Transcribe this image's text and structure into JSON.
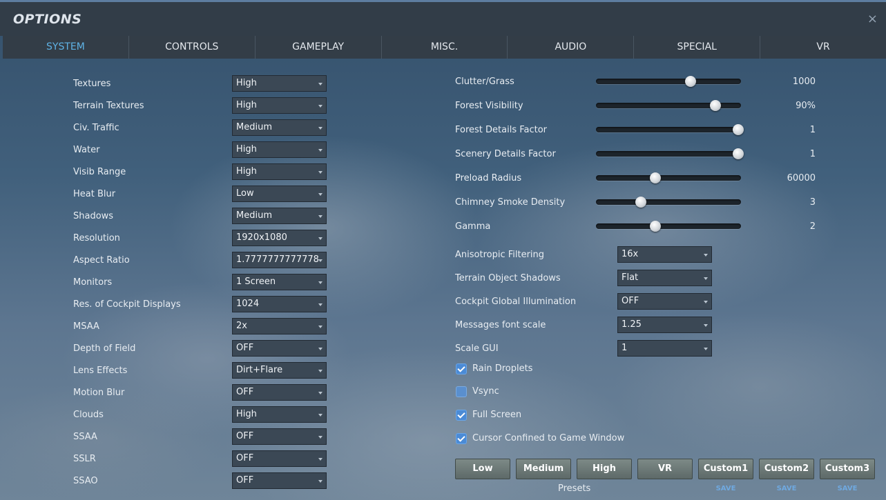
{
  "window": {
    "title": "OPTIONS",
    "close_symbol": "×"
  },
  "tabs": [
    {
      "label": "SYSTEM",
      "active": true
    },
    {
      "label": "CONTROLS"
    },
    {
      "label": "GAMEPLAY"
    },
    {
      "label": "MISC."
    },
    {
      "label": "AUDIO"
    },
    {
      "label": "SPECIAL"
    },
    {
      "label": "VR"
    }
  ],
  "left_settings": [
    {
      "label": "Textures",
      "value": "High"
    },
    {
      "label": "Terrain Textures",
      "value": "High"
    },
    {
      "label": "Civ. Traffic",
      "value": "Medium"
    },
    {
      "label": "Water",
      "value": "High"
    },
    {
      "label": "Visib Range",
      "value": "High"
    },
    {
      "label": "Heat Blur",
      "value": "Low"
    },
    {
      "label": "Shadows",
      "value": "Medium"
    },
    {
      "label": "Resolution",
      "value": "1920x1080"
    },
    {
      "label": "Aspect Ratio",
      "value": "1.7777777777778"
    },
    {
      "label": "Monitors",
      "value": "1 Screen"
    },
    {
      "label": "Res. of Cockpit Displays",
      "value": "1024"
    },
    {
      "label": "MSAA",
      "value": "2x"
    },
    {
      "label": "Depth of Field",
      "value": "OFF"
    },
    {
      "label": "Lens Effects",
      "value": "Dirt+Flare"
    },
    {
      "label": "Motion Blur",
      "value": "OFF"
    },
    {
      "label": "Clouds",
      "value": "High"
    },
    {
      "label": "SSAA",
      "value": "OFF"
    },
    {
      "label": "SSLR",
      "value": "OFF"
    },
    {
      "label": "SSAO",
      "value": "OFF"
    }
  ],
  "sliders": [
    {
      "label": "Clutter/Grass",
      "value": "1000",
      "level": 0.66
    },
    {
      "label": "Forest Visibility",
      "value": "90%",
      "level": 0.84
    },
    {
      "label": "Forest Details Factor",
      "value": "1",
      "level": 1.0
    },
    {
      "label": "Scenery Details Factor",
      "value": "1",
      "level": 1.0
    },
    {
      "label": "Preload Radius",
      "value": "60000",
      "level": 0.41
    },
    {
      "label": "Chimney Smoke Density",
      "value": "3",
      "level": 0.31
    },
    {
      "label": "Gamma",
      "value": "2",
      "level": 0.41
    }
  ],
  "right_dropdowns": [
    {
      "label": "Anisotropic Filtering",
      "value": "16x"
    },
    {
      "label": "Terrain Object Shadows",
      "value": "Flat"
    },
    {
      "label": "Cockpit Global Illumination",
      "value": "OFF"
    },
    {
      "label": "Messages font scale",
      "value": "1.25"
    },
    {
      "label": "Scale GUI",
      "value": "1"
    }
  ],
  "checkboxes": [
    {
      "label": "Rain Droplets",
      "checked": true
    },
    {
      "label": "Vsync",
      "checked": false
    },
    {
      "label": "Full Screen",
      "checked": true
    },
    {
      "label": "Cursor Confined to Game Window",
      "checked": true
    }
  ],
  "presets": {
    "buttons": [
      "Low",
      "Medium",
      "High",
      "VR",
      "Custom1",
      "Custom2",
      "Custom3"
    ],
    "label": "Presets",
    "save_label": "SAVE"
  },
  "colors": {
    "accent": "#5fb3e6",
    "checkbox": "#4b8bd6",
    "header": "#323d48"
  }
}
